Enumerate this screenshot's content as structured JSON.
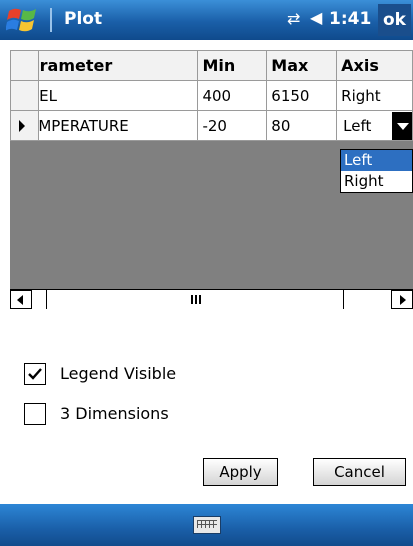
{
  "titlebar": {
    "app_title": "Plot",
    "time": "1:41",
    "ok_label": "ok"
  },
  "table": {
    "columns": [
      "arameter",
      "Min",
      "Max",
      "Axis"
    ],
    "rows": [
      {
        "parameter": "VEL",
        "min": "400",
        "max": "6150",
        "axis": "Right"
      },
      {
        "parameter": "EMPERATURE",
        "min": "-20",
        "max": "80",
        "axis": "Left"
      }
    ],
    "selected_row": 1
  },
  "axis_dropdown": {
    "options": [
      "Left",
      "Right"
    ],
    "selected": "Left"
  },
  "options": {
    "legend_visible_label": "Legend Visible",
    "legend_visible_checked": true,
    "three_d_label": "3 Dimensions",
    "three_d_checked": false
  },
  "buttons": {
    "apply_label": "Apply",
    "cancel_label": "Cancel"
  },
  "icons": {
    "start": "windows-logo-icon",
    "connectivity": "connectivity-icon",
    "volume": "volume-icon",
    "keyboard": "keyboard-icon"
  },
  "colors": {
    "titlebar": "#1a5fa8",
    "selection": "#2d6fc1",
    "grid_background": "#808080"
  }
}
